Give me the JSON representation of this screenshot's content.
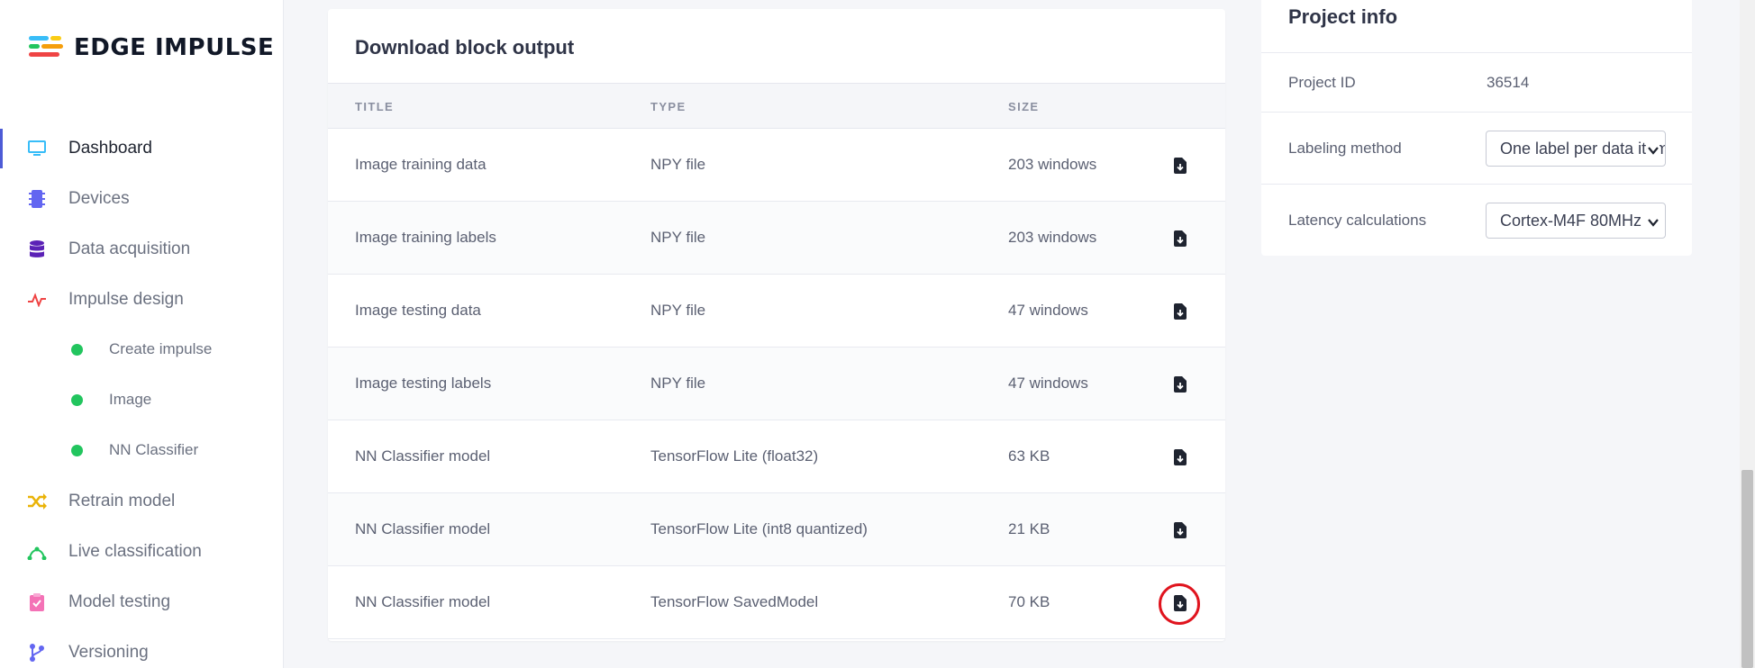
{
  "brand": {
    "name": "EDGE IMPULSE"
  },
  "sidebar": {
    "items": [
      {
        "label": "Dashboard",
        "icon": "monitor-icon",
        "color": "#38bdf8"
      },
      {
        "label": "Devices",
        "icon": "chip-icon",
        "color": "#6366f1"
      },
      {
        "label": "Data acquisition",
        "icon": "database-icon",
        "color": "#5b21b6"
      },
      {
        "label": "Impulse design",
        "icon": "pulse-icon",
        "color": "#ef4444"
      },
      {
        "label": "Retrain model",
        "icon": "shuffle-icon",
        "color": "#eab308"
      },
      {
        "label": "Live classification",
        "icon": "graph-icon",
        "color": "#22c55e"
      },
      {
        "label": "Model testing",
        "icon": "clipboard-check-icon",
        "color": "#f472b6"
      },
      {
        "label": "Versioning",
        "icon": "branch-icon",
        "color": "#6366f1"
      }
    ],
    "subitems": [
      {
        "label": "Create impulse"
      },
      {
        "label": "Image"
      },
      {
        "label": "NN Classifier"
      }
    ],
    "subitem_dot_color": "#22c55e"
  },
  "download": {
    "title": "Download block output",
    "columns": {
      "title": "TITLE",
      "type": "TYPE",
      "size": "SIZE"
    },
    "rows": [
      {
        "title": "Image training data",
        "type": "NPY file",
        "size": "203 windows"
      },
      {
        "title": "Image training labels",
        "type": "NPY file",
        "size": "203 windows"
      },
      {
        "title": "Image testing data",
        "type": "NPY file",
        "size": "47 windows"
      },
      {
        "title": "Image testing labels",
        "type": "NPY file",
        "size": "47 windows"
      },
      {
        "title": "NN Classifier model",
        "type": "TensorFlow Lite (float32)",
        "size": "63 KB"
      },
      {
        "title": "NN Classifier model",
        "type": "TensorFlow Lite (int8 quantized)",
        "size": "21 KB"
      },
      {
        "title": "NN Classifier model",
        "type": "TensorFlow SavedModel",
        "size": "70 KB"
      }
    ],
    "download_icon": "file-download-icon",
    "highlight_color": "#e0141e"
  },
  "project_info": {
    "title": "Project info",
    "project_id_label": "Project ID",
    "project_id": "36514",
    "labeling_label": "Labeling method",
    "labeling_value": "One label per data item",
    "latency_label": "Latency calculations",
    "latency_value": "Cortex-M4F 80MHz"
  }
}
